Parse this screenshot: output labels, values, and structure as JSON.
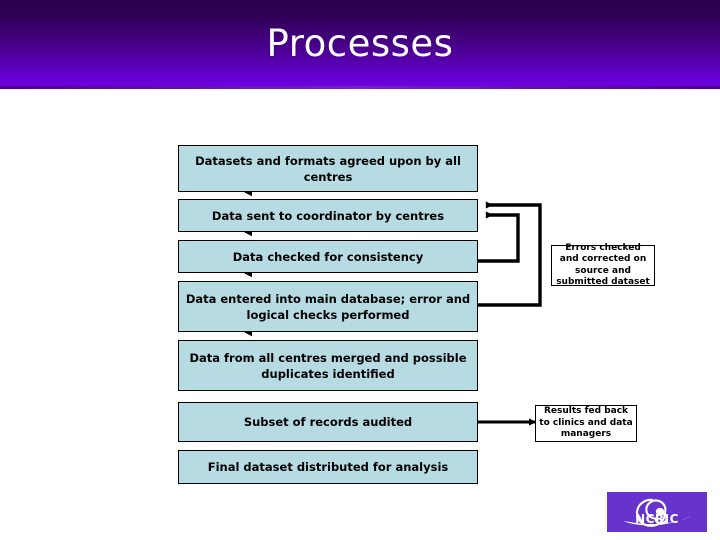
{
  "slide": {
    "title": "Processes",
    "header_gradient_top": "#280047",
    "header_gradient_bottom": "#6f00e0",
    "background": "#ffffff"
  },
  "flowchart": {
    "box_fill": "#b6dbe2",
    "box_border": "#000000",
    "note_fill": "#ffffff",
    "steps": [
      {
        "id": "step-1",
        "label": "Datasets and formats agreed upon by all centres"
      },
      {
        "id": "step-2",
        "label": "Data sent to coordinator by centres"
      },
      {
        "id": "step-3",
        "label": "Data checked for consistency"
      },
      {
        "id": "step-4",
        "label": "Data entered into main database; error and logical checks performed"
      },
      {
        "id": "step-5",
        "label": "Data from all centres merged and possible duplicates identified"
      },
      {
        "id": "step-6",
        "label": "Subset of records audited"
      },
      {
        "id": "step-7",
        "label": "Final dataset distributed for analysis"
      }
    ],
    "notes": [
      {
        "id": "note-errors",
        "label": "Errors checked and corrected on source and submitted dataset"
      },
      {
        "id": "note-results",
        "label": "Results fed back to clinics and data managers"
      }
    ]
  },
  "logo": {
    "text": "NCRIC",
    "background": "#6633cc",
    "mark": "spiral-swoosh"
  }
}
